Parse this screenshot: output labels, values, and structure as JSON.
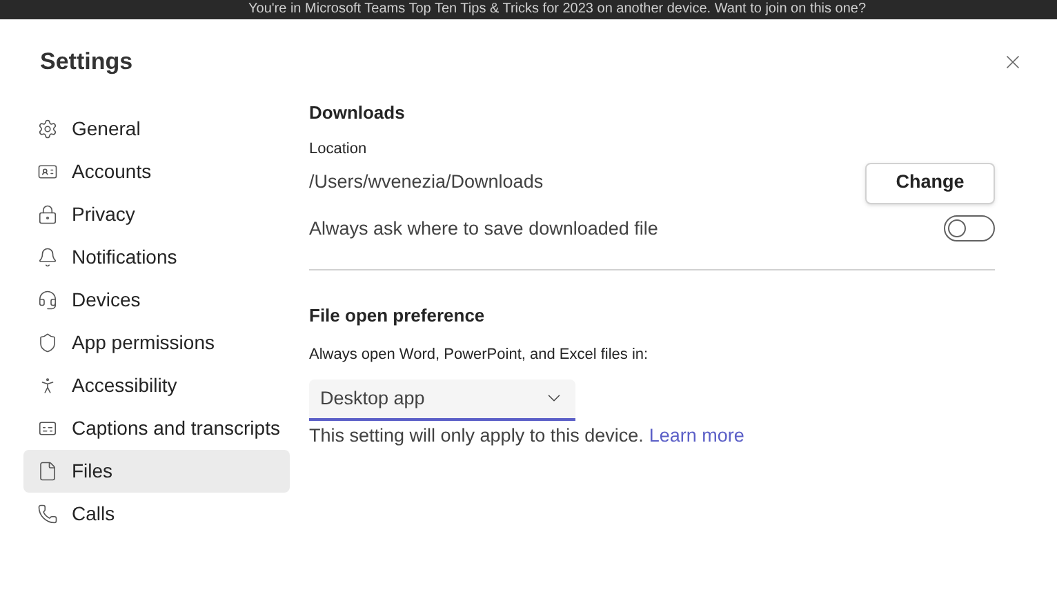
{
  "banner": {
    "text": "You're in Microsoft Teams Top Ten Tips & Tricks for 2023 on another device. Want to join on this one?"
  },
  "dialog": {
    "title": "Settings"
  },
  "sidebar": {
    "items": [
      {
        "label": "General",
        "selected": false
      },
      {
        "label": "Accounts",
        "selected": false
      },
      {
        "label": "Privacy",
        "selected": false
      },
      {
        "label": "Notifications",
        "selected": false
      },
      {
        "label": "Devices",
        "selected": false
      },
      {
        "label": "App permissions",
        "selected": false
      },
      {
        "label": "Accessibility",
        "selected": false
      },
      {
        "label": "Captions and transcripts",
        "selected": false
      },
      {
        "label": "Files",
        "selected": true
      },
      {
        "label": "Calls",
        "selected": false
      }
    ]
  },
  "downloads": {
    "heading": "Downloads",
    "location_label": "Location",
    "location_value": "/Users/wvenezia/Downloads",
    "change_button": "Change",
    "ask_label": "Always ask where to save downloaded file",
    "ask_on": false
  },
  "file_open": {
    "heading": "File open preference",
    "prompt": "Always open Word, PowerPoint, and Excel files in:",
    "dropdown_value": "Desktop app",
    "note": "This setting will only apply to this device.",
    "link": "Learn more"
  }
}
